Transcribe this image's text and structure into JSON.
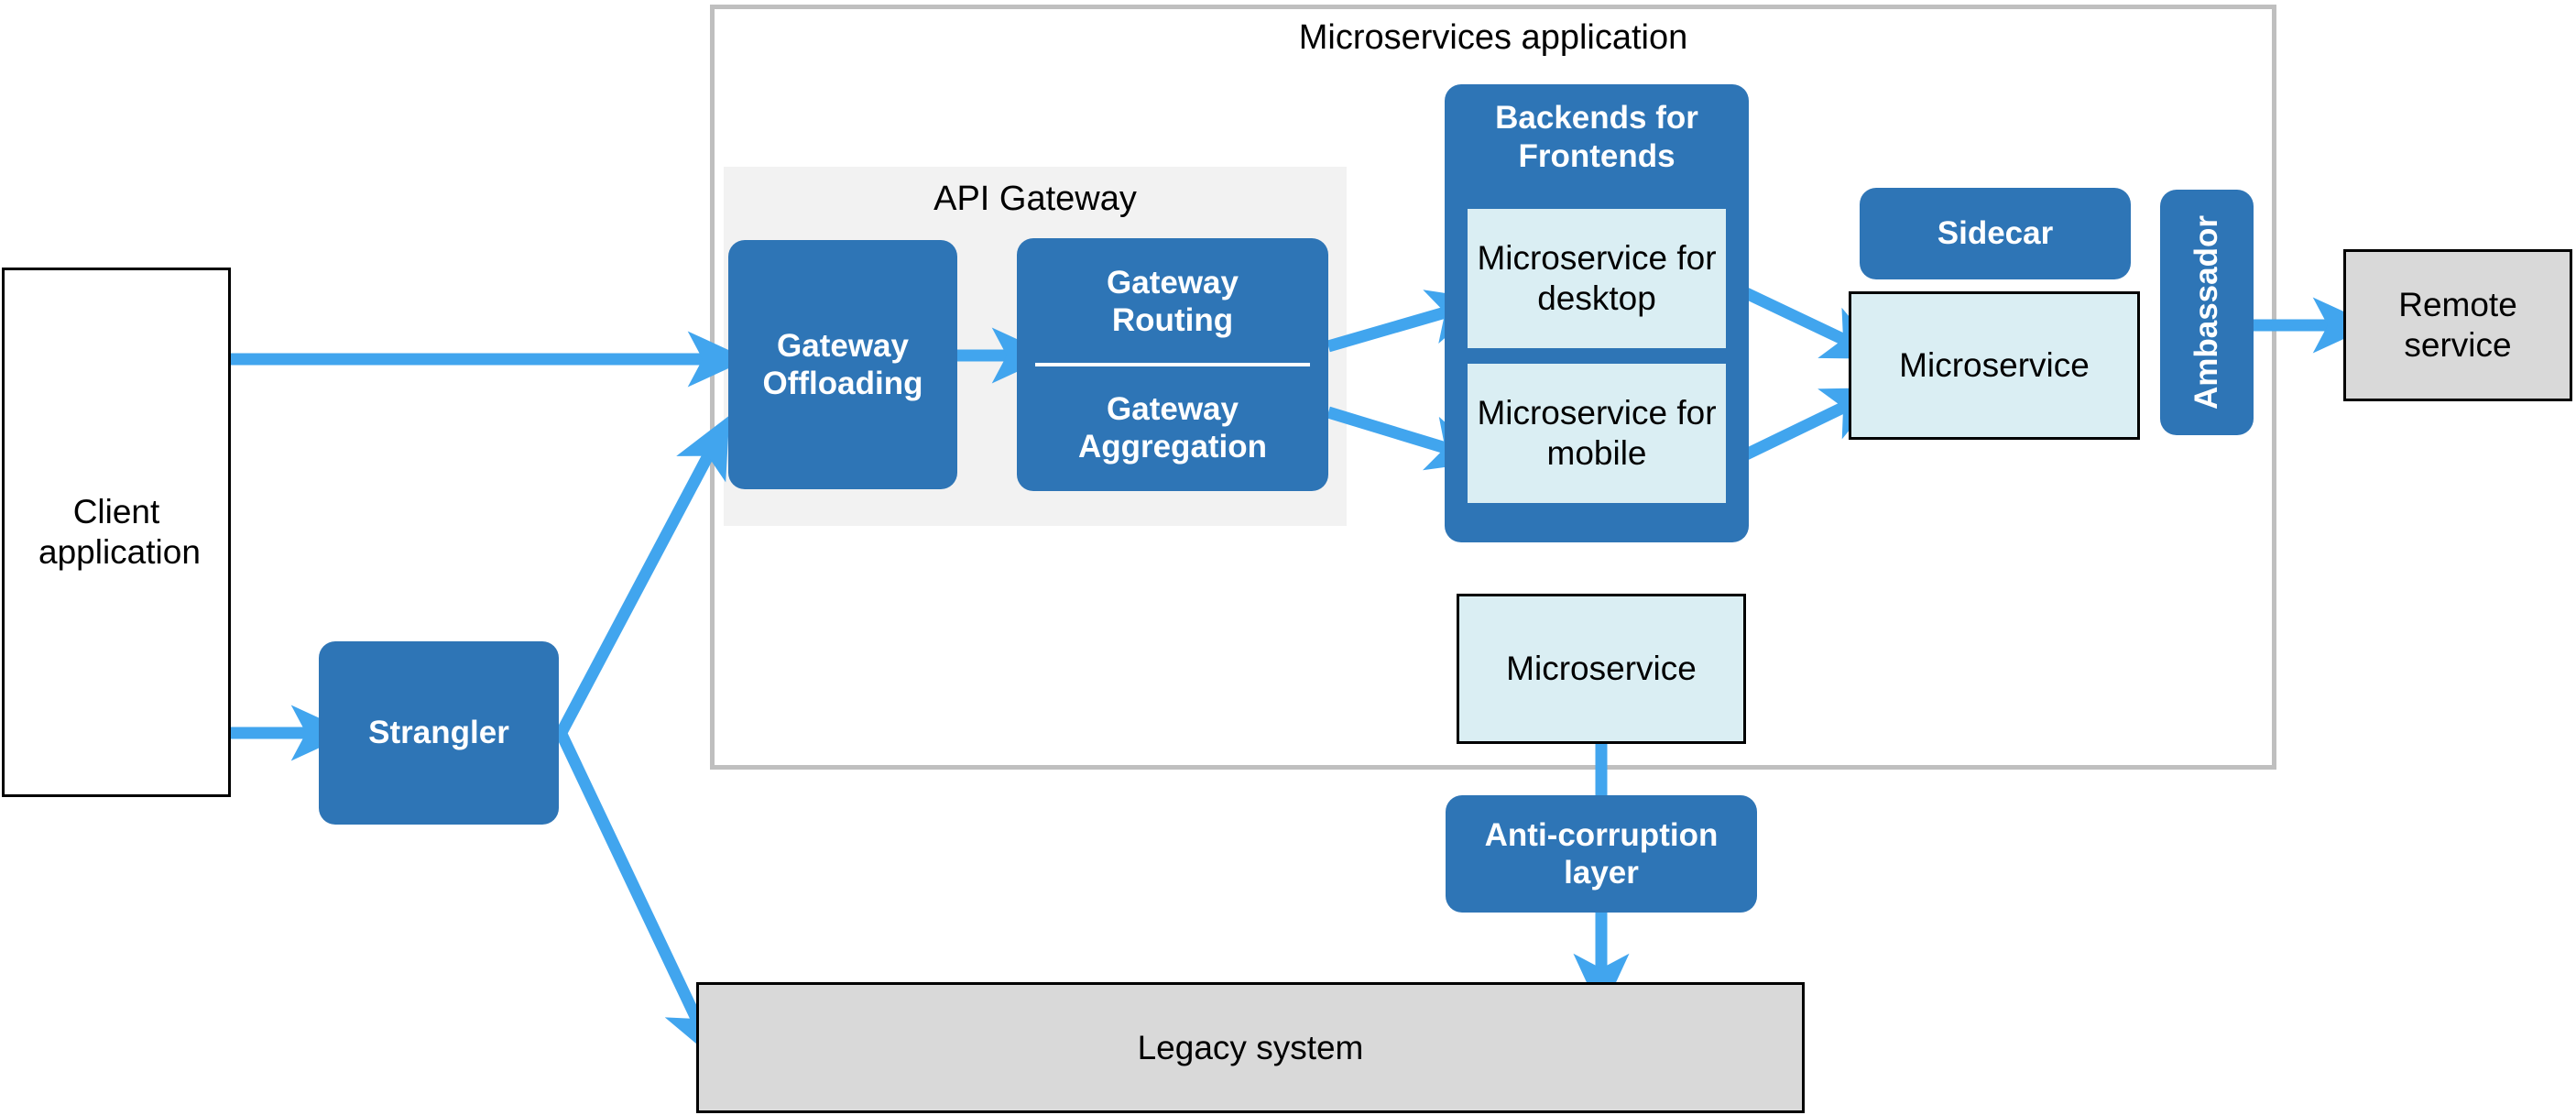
{
  "diagram": {
    "title_visible": false,
    "colors": {
      "accent_blue_fill": "#2e75b6",
      "arrow_blue": "#41A5EE",
      "light_blue_fill": "#daeef3",
      "gray_fill": "#d9d9d9",
      "panel_gray": "#f2f2f2",
      "container_border": "#bfbfbf",
      "outline_black": "#000000",
      "text_white": "#ffffff",
      "text_black": "#000000"
    }
  },
  "containers": {
    "microservices_application": {
      "label": "Microservices application"
    },
    "api_gateway": {
      "label": "API Gateway"
    },
    "backends_for_frontends": {
      "label": "Backends for Frontends"
    }
  },
  "nodes": {
    "client_application": {
      "label": "Client application",
      "style": "white-outlined"
    },
    "strangler": {
      "label": "Strangler",
      "style": "blue-rounded"
    },
    "gateway_offloading": {
      "label": "Gateway Offloading",
      "style": "blue-rounded"
    },
    "gateway_routing": {
      "label": "Gateway Routing",
      "style": "blue-rounded"
    },
    "gateway_aggregation": {
      "label": "Gateway Aggregation",
      "style": "blue-rounded"
    },
    "microservice_for_desktop": {
      "label": "Microservice for desktop",
      "style": "light-blue"
    },
    "microservice_for_mobile": {
      "label": "Microservice for mobile",
      "style": "light-blue"
    },
    "sidecar": {
      "label": "Sidecar",
      "style": "blue-rounded"
    },
    "microservice_sidecar_host": {
      "label": "Microservice",
      "style": "light-blue-outlined"
    },
    "ambassador": {
      "label": "Ambassador",
      "style": "blue-rounded-vertical"
    },
    "remote_service": {
      "label": "Remote service",
      "style": "gray-outlined"
    },
    "microservice_legacy_facing": {
      "label": "Microservice",
      "style": "light-blue-outlined"
    },
    "anti_corruption_layer": {
      "label": "Anti-corruption layer",
      "style": "blue-rounded"
    },
    "legacy_system": {
      "label": "Legacy system",
      "style": "gray-outlined"
    }
  },
  "edges": [
    {
      "from": "client_application",
      "to": "gateway_offloading",
      "kind": "arrow"
    },
    {
      "from": "client_application",
      "to": "strangler",
      "kind": "arrow"
    },
    {
      "from": "strangler",
      "to": "api_gateway",
      "kind": "arrow"
    },
    {
      "from": "strangler",
      "to": "legacy_system",
      "kind": "arrow"
    },
    {
      "from": "gateway_offloading",
      "to": "gateway_routing",
      "kind": "arrow"
    },
    {
      "from": "gateway_aggregation",
      "to": "microservice_for_desktop",
      "kind": "arrow"
    },
    {
      "from": "gateway_aggregation",
      "to": "microservice_for_mobile",
      "kind": "arrow"
    },
    {
      "from": "microservice_for_desktop",
      "to": "microservice_sidecar_host",
      "kind": "arrow"
    },
    {
      "from": "microservice_for_mobile",
      "to": "microservice_sidecar_host",
      "kind": "arrow"
    },
    {
      "from": "ambassador",
      "to": "remote_service",
      "kind": "arrow"
    },
    {
      "from": "microservice_legacy_facing",
      "to": "anti_corruption_layer",
      "kind": "line"
    },
    {
      "from": "anti_corruption_layer",
      "to": "legacy_system",
      "kind": "arrow"
    }
  ]
}
